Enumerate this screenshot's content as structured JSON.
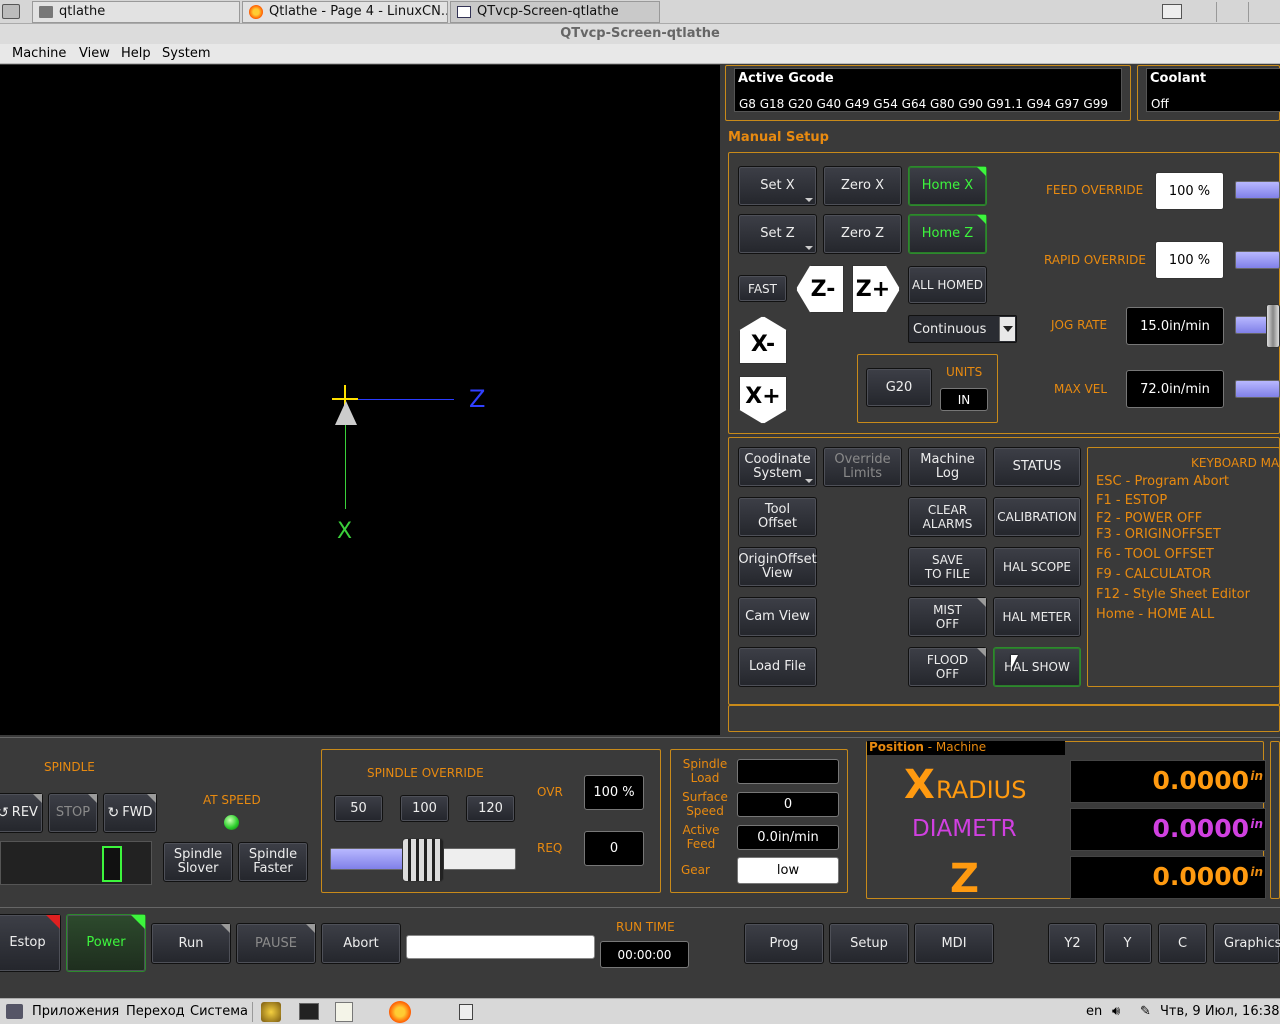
{
  "tabs": [
    {
      "label": "qtlathe"
    },
    {
      "label": "Qtlathe - Page 4 - LinuxCN..."
    },
    {
      "label": "QTvcp-Screen-qtlathe"
    }
  ],
  "window_title": "QTvcp-Screen-qtlathe",
  "menu": [
    "Machine",
    "View",
    "Help",
    "System"
  ],
  "graphics": {
    "z_label": "Z",
    "x_label": "X"
  },
  "active_gcode": {
    "title": "Active Gcode",
    "value": "G8 G18 G20 G40 G49 G54 G64 G80 G90 G91.1 G94 G97 G99"
  },
  "coolant": {
    "title": "Coolant",
    "value": "Off"
  },
  "manual_setup": {
    "title": "Manual Setup",
    "set_x": "Set X",
    "zero_x": "Zero X",
    "home_x": "Home X",
    "set_z": "Set Z",
    "zero_z": "Zero Z",
    "home_z": "Home Z",
    "fast": "FAST",
    "all_homed": "ALL HOMED",
    "jog_mode": "Continuous",
    "jog_z_minus": "Z-",
    "jog_z_plus": "Z+",
    "jog_x_minus": "X-",
    "jog_x_plus": "X+",
    "g20": "G20",
    "units_label": "UNITS",
    "units_value": "IN"
  },
  "overrides": {
    "feed_label": "FEED OVERRIDE",
    "feed_value": "100 %",
    "feed_level_pct": 100,
    "rapid_label": "RAPID OVERRIDE",
    "rapid_value": "100 %",
    "rapid_level_pct": 100,
    "jog_label": "JOG RATE",
    "jog_value": "15.0in/min",
    "jog_level_pct": 30,
    "maxvel_label": "MAX VEL",
    "maxvel_value": "72.0in/min",
    "maxvel_level_pct": 100
  },
  "buttons": {
    "coord_system": [
      "Coodinate",
      "System"
    ],
    "override_limits": [
      "Override",
      "Limits"
    ],
    "machine_log": [
      "Machine",
      "Log"
    ],
    "status": "STATUS",
    "tool_offset": [
      "Tool",
      "Offset"
    ],
    "clear_alarms": [
      "CLEAR",
      "ALARMS"
    ],
    "calibration": "CALIBRATION",
    "origin_offset": [
      "OriginOffset",
      "View"
    ],
    "save_to_file": [
      "SAVE",
      "TO FILE"
    ],
    "hal_scope": "HAL SCOPE",
    "cam_view": "Cam View",
    "mist_off": [
      "MIST",
      "OFF"
    ],
    "hal_meter": "HAL METER",
    "load_file": "Load File",
    "flood_off": [
      "FLOOD",
      "OFF"
    ],
    "hal_show": "HAL SHOW"
  },
  "keyboard_map": {
    "title": "KEYBOARD MAP",
    "items": [
      "ESC - Program Abort",
      "F1 - ESTOP",
      "F2 - POWER OFF",
      "F3 - ORIGINOFFSET",
      "F6 - TOOL OFFSET",
      "F9 - CALCULATOR",
      "F12 - Style Sheet Editor",
      "Home - HOME ALL"
    ]
  },
  "spindle": {
    "title": "SPINDLE",
    "rev": "REV",
    "stop": "STOP",
    "fwd": "FWD",
    "at_speed": "AT SPEED",
    "slower": [
      "Spindle",
      "Slover"
    ],
    "faster": [
      "Spindle",
      "Faster"
    ]
  },
  "spindle_override": {
    "title": "SPINDLE OVERRIDE",
    "presets": [
      "50",
      "100",
      "120"
    ],
    "ovr_label": "OVR",
    "ovr_value": "100 %",
    "req_label": "REQ",
    "req_value": "0",
    "level_pct": 40
  },
  "spindle_info": {
    "load_label": [
      "Spindle",
      "Load"
    ],
    "load_value": "",
    "surface_label": [
      "Surface",
      "Speed"
    ],
    "surface_value": "0",
    "feed_label": [
      "Active",
      "Feed"
    ],
    "feed_value": "0.0in/min",
    "gear_label": "Gear",
    "gear_value": "low"
  },
  "position": {
    "title": "Position",
    "mode": "Machine",
    "x_letter": "X",
    "x_sub": "RADIUS",
    "x_value": "0.0000",
    "x_unit": "in",
    "diam_label": "DIAMETR",
    "diam_value": "0.0000",
    "diam_unit": "in",
    "z_letter": "Z",
    "z_value": "0.0000",
    "z_unit": "in"
  },
  "bottom": {
    "estop": "Estop",
    "power": "Power",
    "run": "Run",
    "pause": "PAUSE",
    "abort": "Abort",
    "run_time_label": "RUN TIME",
    "run_time": "00:00:00",
    "prog": "Prog",
    "setup": "Setup",
    "mdi": "MDI",
    "y2": "Y2",
    "y": "Y",
    "c": "C",
    "graphics": "Graphics"
  },
  "taskbar": {
    "apps": "Приложения",
    "go": "Переход",
    "system": "Система",
    "lang": "en",
    "clock": "Чтв, 9 Июл, 16:38"
  },
  "colors": {
    "accent": "#e88a10",
    "green": "#3df53d",
    "magenta": "#d040e0"
  }
}
